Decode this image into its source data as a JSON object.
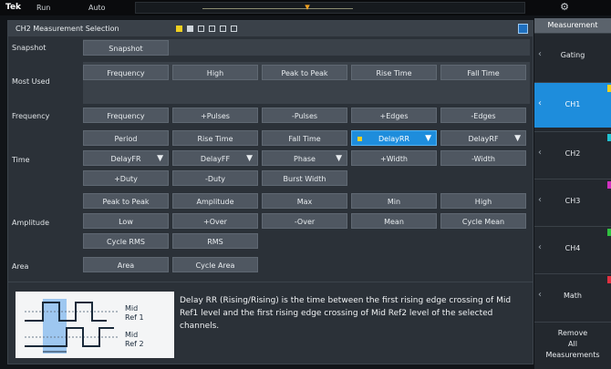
{
  "topbar": {
    "brand": "Tek",
    "run": "Run",
    "mode": "Auto"
  },
  "dialog": {
    "title": "CH2 Measurement Selection",
    "rows": {
      "snapshot": {
        "label": "Snapshot",
        "buttons": [
          "Snapshot"
        ]
      },
      "most_used": {
        "label": "Most Used",
        "buttons": [
          "Frequency",
          "High",
          "Peak to Peak",
          "Rise Time",
          "Fall Time"
        ]
      },
      "frequency": {
        "label": "Frequency",
        "buttons": [
          "Frequency",
          "+Pulses",
          "-Pulses",
          "+Edges",
          "-Edges"
        ]
      },
      "time": {
        "label": "Time",
        "buttons": [
          "Period",
          "Rise Time",
          "Fall Time",
          "DelayRR",
          "DelayRF",
          "DelayFR",
          "DelayFF",
          "Phase",
          "+Width",
          "-Width",
          "+Duty",
          "-Duty",
          "Burst Width"
        ]
      },
      "amplitude": {
        "label": "Amplitude",
        "buttons": [
          "Peak to Peak",
          "Amplitude",
          "Max",
          "Min",
          "High",
          "Low",
          "+Over",
          "-Over",
          "Mean",
          "Cycle Mean",
          "Cycle RMS",
          "RMS"
        ]
      },
      "area": {
        "label": "Area",
        "buttons": [
          "Area",
          "Cycle Area"
        ]
      }
    },
    "diagram": {
      "mid_ref1": "Mid\nRef 1",
      "mid_ref2": "Mid\nRef 2",
      "mid_ref1_a": "Mid",
      "mid_ref1_b": "Ref 1",
      "mid_ref2_a": "Mid",
      "mid_ref2_b": "Ref 2"
    },
    "description": "Delay RR (Rising/Rising) is the time between the first rising edge crossing of Mid Ref1 level and the first rising edge crossing of Mid Ref2 level of the selected channels."
  },
  "right_panel": {
    "title": "Measurement",
    "items": [
      "Gating",
      "CH1",
      "CH2",
      "CH3",
      "CH4",
      "Math"
    ],
    "remove": [
      "Remove",
      "All",
      "Measurements"
    ]
  },
  "colors": {
    "accent": "#1e8ddc",
    "ch1": "#f0d020",
    "ch2": "#20c0d0",
    "ch3": "#d030c0",
    "ch4": "#30c040",
    "math": "#e03040"
  }
}
